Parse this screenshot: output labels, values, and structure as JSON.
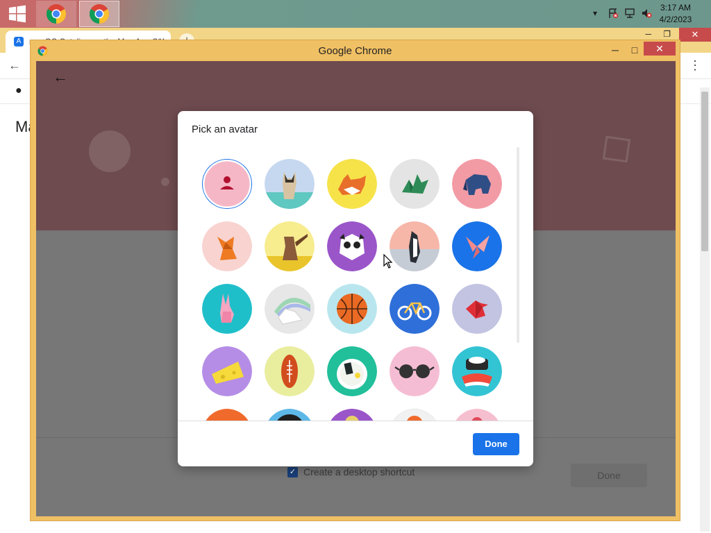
{
  "taskbar": {
    "clock_time": "3:17 AM",
    "clock_date": "4/2/2023"
  },
  "background_chrome": {
    "tab_title": "macOS Catalina on the Mac App Store",
    "heading_fragment": "Ma"
  },
  "window": {
    "title": "Google Chrome",
    "desktop_shortcut_label": "Create a desktop shortcut",
    "background_done_label": "Done"
  },
  "dialog": {
    "title": "Pick an avatar",
    "done_label": "Done",
    "avatars": [
      {
        "name": "generic-person",
        "selected": true
      },
      {
        "name": "cat"
      },
      {
        "name": "corgi"
      },
      {
        "name": "dragon"
      },
      {
        "name": "elephant"
      },
      {
        "name": "fox"
      },
      {
        "name": "monkey"
      },
      {
        "name": "panda"
      },
      {
        "name": "penguin"
      },
      {
        "name": "butterfly"
      },
      {
        "name": "rabbit"
      },
      {
        "name": "unicorn"
      },
      {
        "name": "basketball"
      },
      {
        "name": "bike"
      },
      {
        "name": "bird"
      },
      {
        "name": "cheese"
      },
      {
        "name": "football"
      },
      {
        "name": "ramen"
      },
      {
        "name": "sunglasses"
      },
      {
        "name": "sushi"
      }
    ]
  },
  "colors": {
    "accent": "#1a73e8",
    "window_frame": "#f0c064",
    "banner": "#6e4b4f",
    "close_red": "#c74b4b"
  }
}
